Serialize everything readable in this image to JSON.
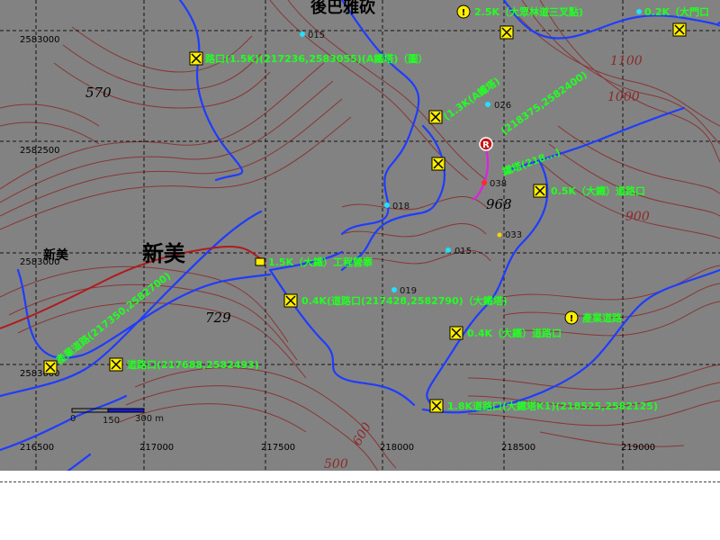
{
  "map": {
    "grid_easting": [
      "216500",
      "217000",
      "217500",
      "218000",
      "218500",
      "219000"
    ],
    "grid_northing": [
      "2583000",
      "2582500",
      "2583000",
      "2583000"
    ],
    "places": [
      {
        "id": "houbaya",
        "label": "後巴雅砍"
      },
      {
        "id": "xinmei-big",
        "label": "新美"
      },
      {
        "id": "xinmei-small",
        "label": "新美"
      }
    ],
    "elevations": [
      "570",
      "968",
      "729"
    ],
    "contour_labels": [
      "1100",
      "1000",
      "900",
      "600",
      "500"
    ],
    "points": [
      {
        "id": "p015a",
        "label": "015"
      },
      {
        "id": "p026",
        "label": "026"
      },
      {
        "id": "p018",
        "label": "018"
      },
      {
        "id": "p015b",
        "label": "015"
      },
      {
        "id": "p019",
        "label": "019"
      },
      {
        "id": "p033",
        "label": "033"
      },
      {
        "id": "p038",
        "label": "038"
      }
    ],
    "waypoint_labels": [
      "2.5K（大眾林道三叉點)",
      "0.2K（大門口",
      "路口(1.5K)(217236,2583055)(A鐵塔)（圖）",
      "(1.3K(A鐵塔)",
      "(218375,2582400)",
      "鐵塔(218...)",
      "0.5K（大鐵）道路口",
      "1.5K（大鐵）工程營寨",
      "0.4K(道路口(217428,2582790)（大鐵塔)",
      "0.4K（大鐵）道路口",
      "產業道路",
      "產業道路(217350,2582700)",
      "道路口(217688,2582493)",
      "1.8K道路口(大鐵塔K1)(218525,2582125)"
    ],
    "scale": {
      "ticks": [
        "0",
        "150",
        "300 m"
      ]
    },
    "marker_letter": "R"
  }
}
